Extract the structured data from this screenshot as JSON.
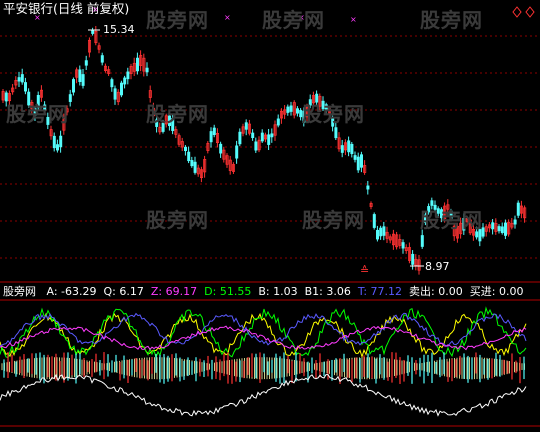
{
  "chart_title": "平安银行(日线 前复权)",
  "nav_icons": [
    "diamond-outline-icon",
    "diamond-outline-icon"
  ],
  "price_panel": {
    "high_label": "15.34",
    "low_label": "8.97",
    "signal_mark": "≙"
  },
  "indicator": {
    "name": "股旁网",
    "fields": [
      {
        "label": "A:",
        "value": "-63.29",
        "color": "#ffffff"
      },
      {
        "label": "Q:",
        "value": "6.17",
        "color": "#ffffff"
      },
      {
        "label": "Z:",
        "value": "69.17",
        "color": "#ff3cff"
      },
      {
        "label": "D:",
        "value": "51.55",
        "color": "#00ff00"
      },
      {
        "label": "B:",
        "value": "1.03",
        "color": "#ffffff"
      },
      {
        "label": "B1:",
        "value": "3.06",
        "color": "#ffffff"
      },
      {
        "label": "T:",
        "value": "77.12",
        "color": "#5a5aff"
      },
      {
        "label": "卖出:",
        "value": "0.00",
        "color": "#ffffff"
      },
      {
        "label": "买进:",
        "value": "0.00",
        "color": "#ffffff"
      }
    ]
  },
  "watermarks": [
    "股旁网",
    "股旁网",
    "股旁网",
    "股旁网",
    "股旁网",
    "股旁网",
    "股旁网",
    "股旁网",
    "股旁网"
  ],
  "colors": {
    "up": "#ff3232",
    "down": "#54fcfc",
    "grid": "#8b0000",
    "axis": "#b00000",
    "label": "#c0c0c0"
  }
}
